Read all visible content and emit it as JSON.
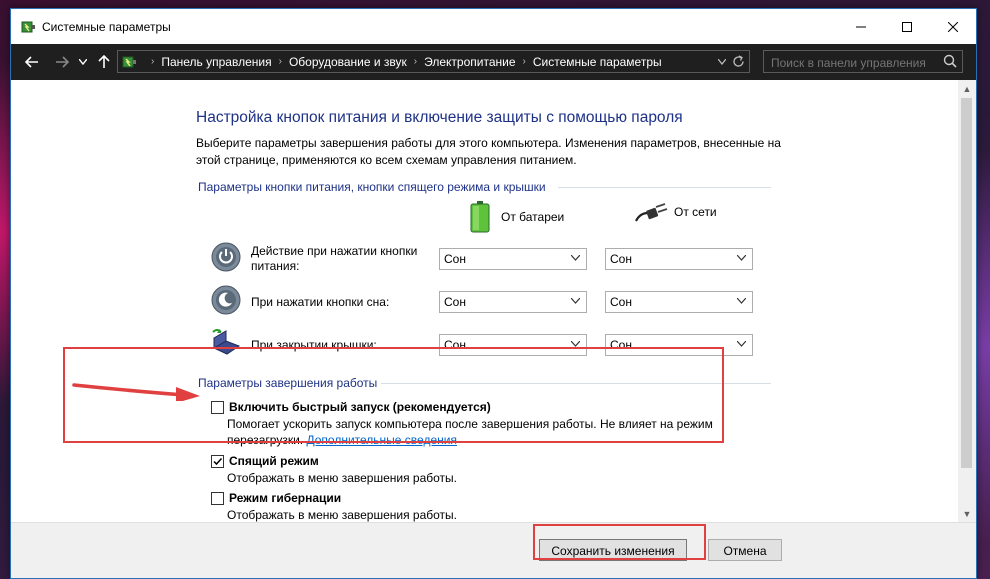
{
  "window": {
    "title": "Системные параметры"
  },
  "address": {
    "breadcrumbs": [
      "Панель управления",
      "Оборудование и звук",
      "Электропитание",
      "Системные параметры"
    ],
    "search_placeholder": "Поиск в панели управления"
  },
  "page": {
    "title": "Настройка кнопок питания и включение защиты с помощью пароля",
    "description": "Выберите параметры завершения работы для этого компьютера. Изменения параметров, внесенные на этой странице, применяются ко всем схемам управления питанием."
  },
  "buttons_group": {
    "label": "Параметры кнопки питания, кнопки спящего режима и крышки",
    "col_battery": "От батареи",
    "col_ac": "От сети",
    "rows": [
      {
        "label": "Действие при нажатии кнопки питания:",
        "battery": "Сон",
        "ac": "Сон"
      },
      {
        "label": "При нажатии кнопки сна:",
        "battery": "Сон",
        "ac": "Сон"
      },
      {
        "label": "При закрытии крышки:",
        "battery": "Сон",
        "ac": "Сон"
      }
    ]
  },
  "shutdown_group": {
    "label": "Параметры завершения работы",
    "options": [
      {
        "label": "Включить быстрый запуск (рекомендуется)",
        "checked": false,
        "desc": "Помогает ускорить запуск компьютера после завершения работы. Не влияет на режим перезагрузки.",
        "link": "Дополнительные сведения"
      },
      {
        "label": "Спящий режим",
        "checked": true,
        "desc": "Отображать в меню завершения работы."
      },
      {
        "label": "Режим гибернации",
        "checked": false,
        "desc": "Отображать в меню завершения работы."
      }
    ]
  },
  "footer": {
    "save_label": "Сохранить изменения",
    "cancel_label": "Отмена"
  },
  "colors": {
    "title_blue": "#1e3287",
    "highlight_red": "#e04040",
    "link_blue": "#0066cc"
  }
}
